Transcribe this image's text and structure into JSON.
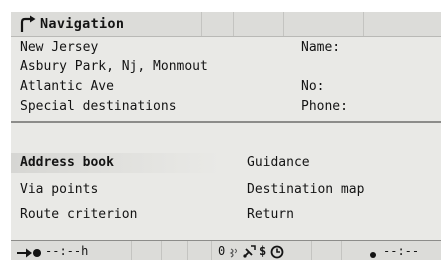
{
  "title": {
    "text": "Navigation",
    "icon": "turn-right-arrow-icon"
  },
  "address": {
    "state": "New Jersey",
    "city": "Asbury Park, Nj, Monmout",
    "street": "Atlantic Ave",
    "special": "Special destinations"
  },
  "fields": {
    "name_label": "Name:",
    "no_label": "No:",
    "phone_label": "Phone:"
  },
  "menu": {
    "address_book": "Address book",
    "via_points": "Via points",
    "route_criterion": "Route criterion",
    "guidance": "Guidance",
    "destination_map": "Destination map",
    "return": "Return"
  },
  "status": {
    "arrival_time": "--:--h",
    "count": "0",
    "clock": "--:--",
    "icons": [
      "arrow-to-destination-icon",
      "signal-icon",
      "gps-satellite-icon",
      "dollar-icon",
      "clock-icon",
      "dot-icon"
    ]
  }
}
